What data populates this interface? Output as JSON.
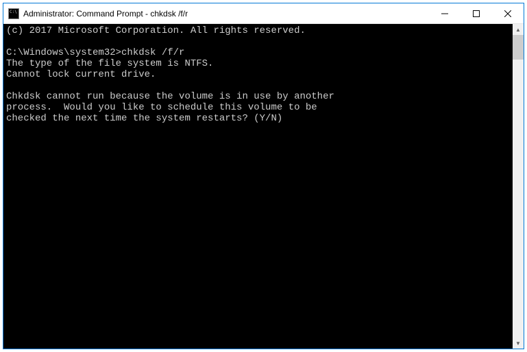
{
  "window": {
    "title": "Administrator: Command Prompt - chkdsk  /f/r"
  },
  "console": {
    "lines": [
      "(c) 2017 Microsoft Corporation. All rights reserved.",
      "",
      "C:\\Windows\\system32>chkdsk /f/r",
      "The type of the file system is NTFS.",
      "Cannot lock current drive.",
      "",
      "Chkdsk cannot run because the volume is in use by another",
      "process.  Would you like to schedule this volume to be",
      "checked the next time the system restarts? (Y/N)"
    ]
  }
}
